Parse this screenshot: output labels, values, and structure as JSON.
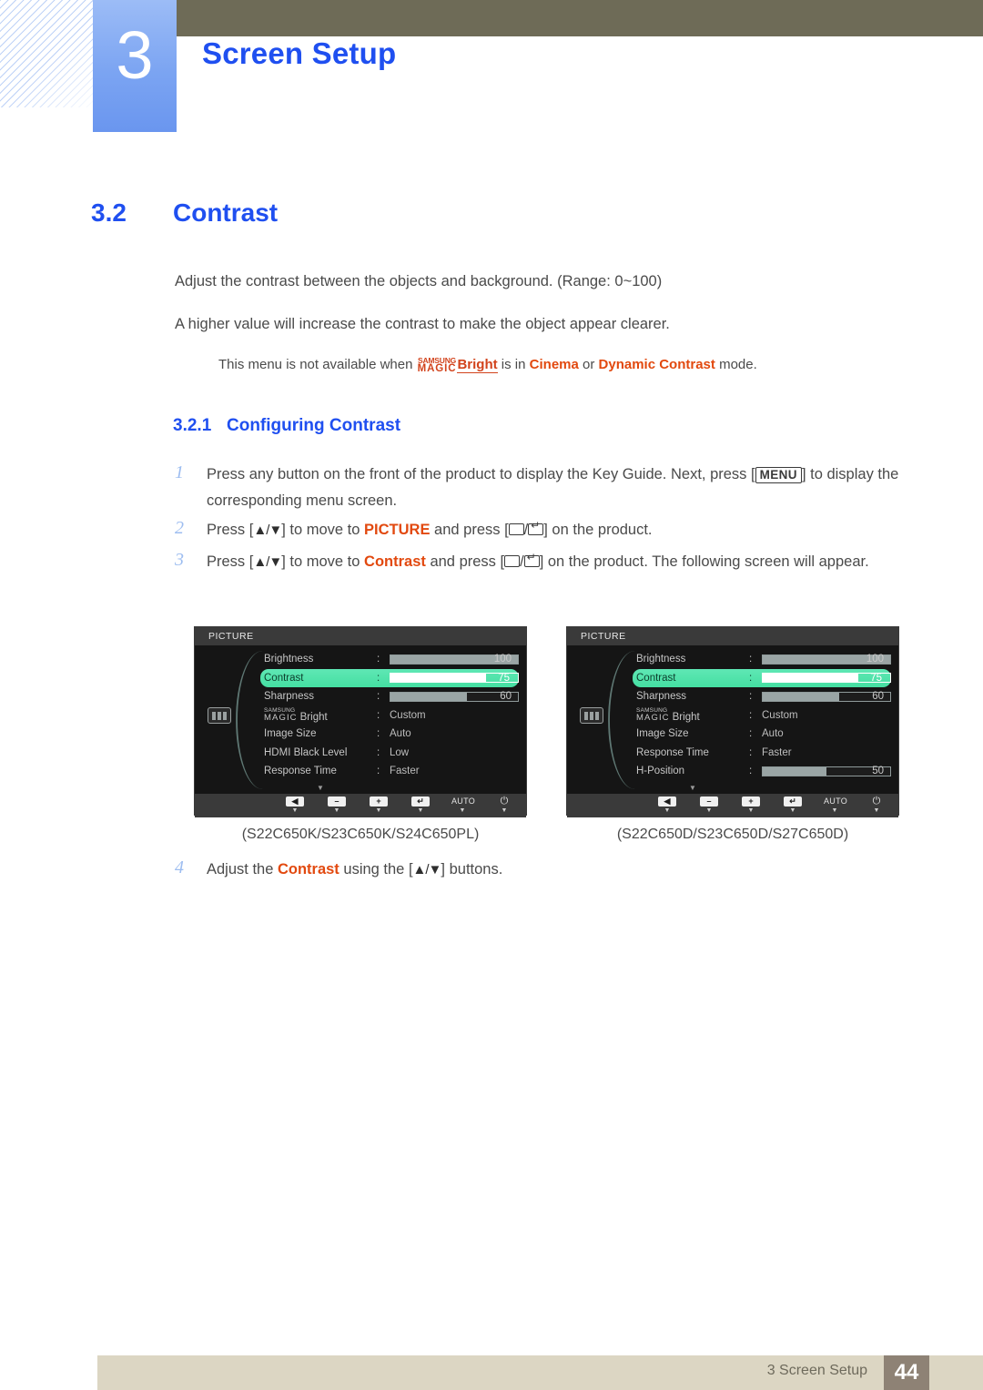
{
  "chapter": {
    "number": "3",
    "title": "Screen Setup"
  },
  "section": {
    "number": "3.2",
    "title": "Contrast"
  },
  "paragraphs": {
    "p1": "Adjust the contrast between the objects and background. (Range: 0~100)",
    "p2": "A higher value will increase the contrast to make the object appear clearer."
  },
  "note": {
    "lead": "This menu is not available when ",
    "magic_samsung": "SAMSUNG",
    "magic_magic": "MAGIC",
    "magic_bright": "Bright",
    "mid": " is in ",
    "mode1": "Cinema",
    "conj": " or ",
    "mode2": "Dynamic Contrast",
    "tail": " mode."
  },
  "subsection": {
    "number": "3.2.1",
    "title": "Configuring Contrast"
  },
  "steps": [
    {
      "number": "1",
      "pre": "Press any button on the front of the product to display the Key Guide. Next, press [",
      "key": "MENU",
      "post": "] to display the corresponding menu screen."
    },
    {
      "number": "2",
      "pre": "Press [",
      "arrows": "▲/▼",
      "mid": "] to move to ",
      "target": "PICTURE",
      "mid2": " and press [",
      "post": "] on the product."
    },
    {
      "number": "3",
      "pre": "Press [",
      "arrows": "▲/▼",
      "mid": "] to move to ",
      "target": "Contrast",
      "mid2": " and press [",
      "post": "] on the product. The following screen will appear."
    },
    {
      "number": "4",
      "pre": "Adjust the ",
      "target": "Contrast",
      "mid": " using the [",
      "arrows": "▲/▼",
      "post": "] buttons."
    }
  ],
  "osd_left": {
    "title": "PICTURE",
    "category_icon": "picture-icon",
    "rows": [
      {
        "label": "Brightness",
        "type": "bar",
        "fill": 100,
        "value": "100",
        "selected": false
      },
      {
        "label": "Contrast",
        "type": "bar",
        "fill": 75,
        "value": "75",
        "selected": true
      },
      {
        "label": "Sharpness",
        "type": "bar",
        "fill": 60,
        "value": "60",
        "selected": false
      },
      {
        "label": "MAGIC Bright",
        "type": "text",
        "value": "Custom",
        "magic": true,
        "selected": false
      },
      {
        "label": "Image Size",
        "type": "text",
        "value": "Auto",
        "selected": false
      },
      {
        "label": "HDMI Black Level",
        "type": "text",
        "value": "Low",
        "selected": false
      },
      {
        "label": "Response Time",
        "type": "text",
        "value": "Faster",
        "selected": false
      }
    ],
    "footer_buttons": [
      {
        "name": "back-button",
        "glyph": "◀"
      },
      {
        "name": "minus-button",
        "glyph": "–"
      },
      {
        "name": "plus-button",
        "glyph": "+"
      },
      {
        "name": "enter-button",
        "glyph": "↵"
      },
      {
        "name": "auto-button",
        "label": "AUTO"
      },
      {
        "name": "power-button",
        "label": "⏻"
      }
    ]
  },
  "osd_right": {
    "title": "PICTURE",
    "category_icon": "picture-icon",
    "rows": [
      {
        "label": "Brightness",
        "type": "bar",
        "fill": 100,
        "value": "100",
        "selected": false
      },
      {
        "label": "Contrast",
        "type": "bar",
        "fill": 75,
        "value": "75",
        "selected": true
      },
      {
        "label": "Sharpness",
        "type": "bar",
        "fill": 60,
        "value": "60",
        "selected": false
      },
      {
        "label": "MAGIC Bright",
        "type": "text",
        "value": "Custom",
        "magic": true,
        "selected": false
      },
      {
        "label": "Image Size",
        "type": "text",
        "value": "Auto",
        "selected": false
      },
      {
        "label": "Response Time",
        "type": "text",
        "value": "Faster",
        "selected": false
      },
      {
        "label": "H-Position",
        "type": "bar",
        "fill": 50,
        "value": "50",
        "selected": false
      }
    ],
    "footer_buttons": [
      {
        "name": "back-button",
        "glyph": "◀"
      },
      {
        "name": "minus-button",
        "glyph": "–"
      },
      {
        "name": "plus-button",
        "glyph": "+"
      },
      {
        "name": "enter-button",
        "glyph": "↵"
      },
      {
        "name": "auto-button",
        "label": "AUTO"
      },
      {
        "name": "power-button",
        "label": "⏻"
      }
    ]
  },
  "captions": {
    "left": "(S22C650K/S23C650K/S24C650PL)",
    "right": "(S22C650D/S23C650D/S27C650D)"
  },
  "footer": {
    "text": "3 Screen Setup",
    "page": "44"
  },
  "colors": {
    "heading_blue": "#1f4ff0",
    "accent_orange": "#e2490f",
    "osd_highlight": "#4fe0a8",
    "olive_bar": "#6e6b57",
    "footer_bar": "#dcd6c3",
    "page_badge": "#8e8275"
  }
}
